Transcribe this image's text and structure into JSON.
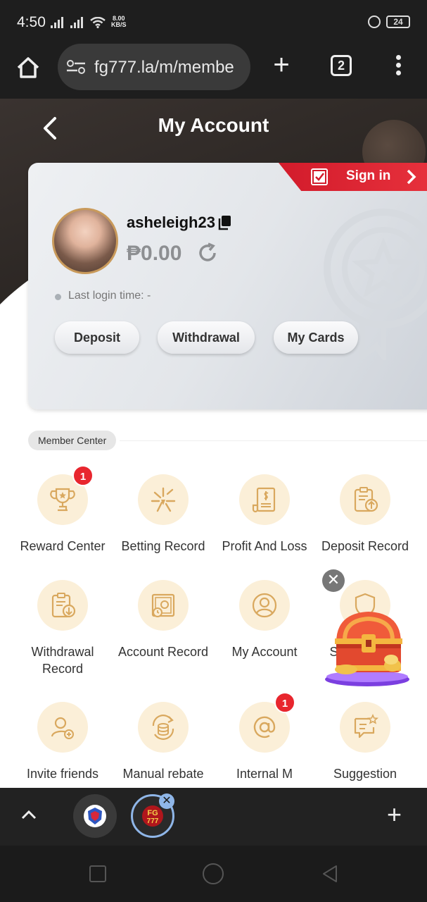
{
  "status": {
    "time": "4:50",
    "net_speed_top": "8.00",
    "net_speed_unit": "KB/S",
    "battery": "24"
  },
  "browser": {
    "url": "fg777.la/m/membe",
    "tab_count": "2"
  },
  "header": {
    "title": "My Account"
  },
  "account": {
    "signin_label": "Sign in",
    "username": "asheleigh23",
    "balance": "₱0.00",
    "last_login": "Last login time: -",
    "actions": [
      "Deposit",
      "Withdrawal",
      "My Cards"
    ]
  },
  "member_center": {
    "title": "Member Center",
    "items": [
      {
        "label": "Reward Center",
        "icon": "trophy-icon",
        "badge": "1"
      },
      {
        "label": "Betting Record",
        "icon": "betting-record-icon"
      },
      {
        "label": "Profit And Loss",
        "icon": "profit-loss-icon"
      },
      {
        "label": "Deposit Record",
        "icon": "deposit-record-icon"
      },
      {
        "label": "Withdrawal Record",
        "icon": "withdrawal-record-icon"
      },
      {
        "label": "Account Record",
        "icon": "account-record-icon"
      },
      {
        "label": "My Account",
        "icon": "user-icon"
      },
      {
        "label": "Security Center",
        "icon": "shield-icon",
        "visible_text": "Sec",
        "visible_text_end": "er"
      },
      {
        "label": "Invite friends",
        "icon": "invite-friends-icon"
      },
      {
        "label": "Manual rebate",
        "icon": "rebate-icon"
      },
      {
        "label": "Internal M",
        "icon": "at-sign-icon",
        "badge": "1"
      },
      {
        "label": "Suggestion",
        "icon": "suggestion-icon"
      }
    ]
  },
  "colors": {
    "accent_red": "#e8262e",
    "icon_bg": "#fbefd8",
    "icon_stroke": "#d9a85e",
    "header_bg": "#2c2623"
  }
}
